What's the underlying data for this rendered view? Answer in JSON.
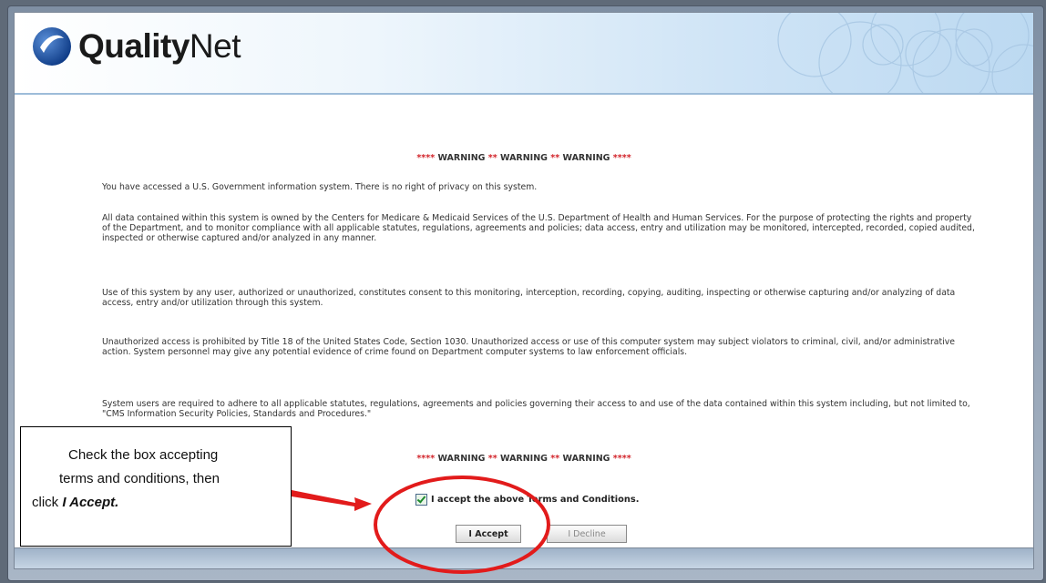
{
  "header": {
    "logo_bold": "Quality",
    "logo_regular": "Net"
  },
  "warning": {
    "stars_left": "****",
    "sep": "**",
    "stars_right": "****",
    "word": "WARNING"
  },
  "paragraphs": [
    "You have accessed a U.S. Government information system. There is no right of privacy on this system.",
    "All data contained within this system is owned by the Centers for Medicare & Medicaid Services of the U.S. Department of Health and Human Services. For the purpose of protecting the rights and property of the Department, and to monitor compliance with all applicable statutes, regulations, agreements and policies; data access, entry and utilization may be monitored, intercepted, recorded, copied audited, inspected or otherwise captured and/or analyzed in any manner.",
    "Use of this system by any user, authorized or unauthorized, constitutes consent to this monitoring, interception, recording, copying, auditing, inspecting or otherwise capturing and/or analyzing of data access, entry and/or utilization through this system.",
    "Unauthorized access is prohibited by Title 18 of the United States Code, Section 1030. Unauthorized access or use of this computer system may subject violators to criminal, civil, and/or administrative action. System personnel may give any potential evidence of crime found on Department computer systems to law enforcement officials.",
    "System users are required to adhere to all applicable statutes, regulations, agreements and policies governing their access to and use of the data contained within this system including, but not limited to, \"CMS Information Security Policies, Standards and Procedures.\""
  ],
  "accept_checkbox": {
    "label": "I accept the above Terms and Conditions.",
    "checked": true
  },
  "buttons": {
    "accept": "I Accept",
    "decline": "I Decline"
  },
  "callout": {
    "line1": "Check the box accepting",
    "line2": "terms and conditions, then",
    "line3_prefix": "click ",
    "line3_emphasis": "I Accept."
  },
  "colors": {
    "warning_star": "#d2232a",
    "annotation_red": "#e21b1b",
    "logo_blue": "#1f4e9e"
  },
  "icons": {
    "logo": "qualitynet-logo-icon",
    "checkbox": "checkbox-checked-icon"
  }
}
